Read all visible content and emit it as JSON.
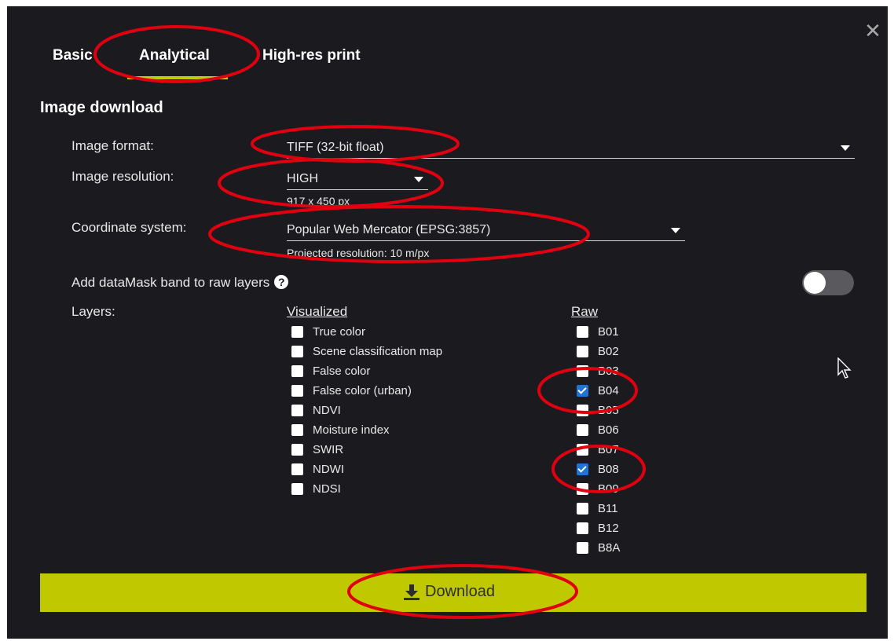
{
  "dialog": {
    "close_icon": "close-icon",
    "tabs": [
      {
        "label": "Basic"
      },
      {
        "label": "Analytical",
        "active": true
      },
      {
        "label": "High-res print"
      }
    ],
    "section_title": "Image download",
    "image_format": {
      "label": "Image format:",
      "value": "TIFF (32-bit float)"
    },
    "image_resolution": {
      "label": "Image resolution:",
      "value": "HIGH",
      "size": "917 x 450 px"
    },
    "coordinate_system": {
      "label": "Coordinate system:",
      "value": "Popular Web Mercator (EPSG:3857)",
      "projected": "Projected resolution: 10 m/px"
    },
    "datamask": {
      "label": "Add dataMask band to raw layers",
      "help": "?",
      "enabled": false
    },
    "layers": {
      "label": "Layers:",
      "visualized_heading": "Visualized",
      "raw_heading": "Raw",
      "visualized": [
        {
          "label": "True color",
          "checked": false
        },
        {
          "label": "Scene classification map",
          "checked": false
        },
        {
          "label": "False color",
          "checked": false
        },
        {
          "label": "False color (urban)",
          "checked": false
        },
        {
          "label": "NDVI",
          "checked": false
        },
        {
          "label": "Moisture index",
          "checked": false
        },
        {
          "label": "SWIR",
          "checked": false
        },
        {
          "label": "NDWI",
          "checked": false
        },
        {
          "label": "NDSI",
          "checked": false
        }
      ],
      "raw": [
        {
          "label": "B01",
          "checked": false
        },
        {
          "label": "B02",
          "checked": false
        },
        {
          "label": "B03",
          "checked": false
        },
        {
          "label": "B04",
          "checked": true
        },
        {
          "label": "B05",
          "checked": false
        },
        {
          "label": "B06",
          "checked": false
        },
        {
          "label": "B07",
          "checked": false
        },
        {
          "label": "B08",
          "checked": true
        },
        {
          "label": "B09",
          "checked": false
        },
        {
          "label": "B11",
          "checked": false
        },
        {
          "label": "B12",
          "checked": false
        },
        {
          "label": "B8A",
          "checked": false
        }
      ]
    },
    "download_button": {
      "label": "Download",
      "icon": "download-icon"
    }
  },
  "colors": {
    "background": "#1b1b1f",
    "accent": "#c0c800",
    "checkbox_checked": "#1f74d6",
    "annotation": "#e0000f"
  }
}
